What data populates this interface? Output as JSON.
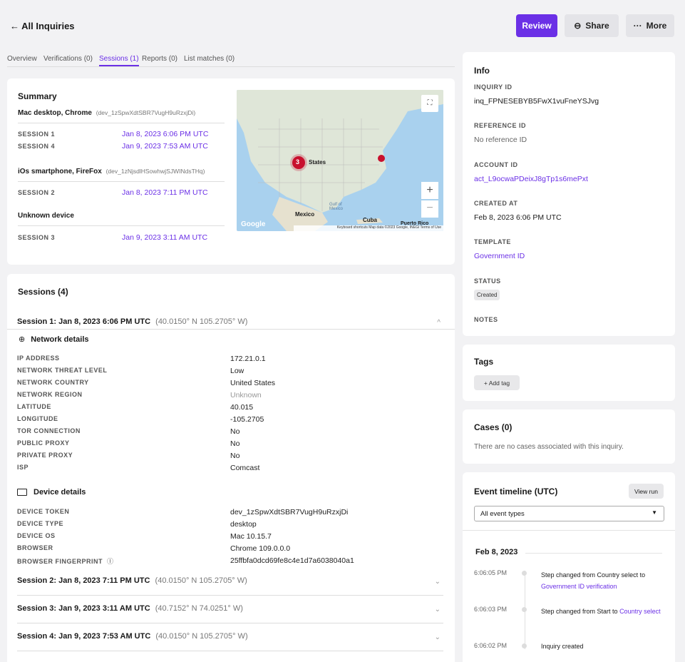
{
  "header": {
    "back_label": "← All Inquiries",
    "review": "Review",
    "share": "Share",
    "more": "More"
  },
  "tabs": [
    {
      "label": "Overview"
    },
    {
      "label": "Verifications (0)"
    },
    {
      "label": "Sessions (1)"
    },
    {
      "label": "Reports (0)"
    },
    {
      "label": "List matches (0)"
    }
  ],
  "summary": {
    "title": "Summary",
    "devices": [
      {
        "name": "Mac desktop, Chrome",
        "id": "(dev_1zSpwXdtSBR7VugH9uRzxjDi)",
        "sessions": [
          {
            "label": "SESSION 1",
            "time": "Jan 8, 2023 6:06 PM UTC"
          },
          {
            "label": "SESSION 4",
            "time": "Jan 9, 2023 7:53 AM UTC"
          }
        ]
      },
      {
        "name": "iOs smartphone, FireFox",
        "id": "(dev_1zNjsdlHSowhwjSJWINdsTHq)",
        "sessions": [
          {
            "label": "SESSION 2",
            "time": "Jan 8, 2023 7:11 PM UTC"
          }
        ]
      },
      {
        "name": "Unknown device",
        "id": "",
        "sessions": [
          {
            "label": "SESSION 3",
            "time": "Jan 9, 2023 3:11 AM UTC"
          }
        ]
      }
    ],
    "map": {
      "cluster_count": "3",
      "states_label": "States",
      "mexico": "Mexico",
      "cuba": "Cuba",
      "gulf": "Gulf of Mexico",
      "puerto_rico": "Puerto Rico",
      "google": "Google",
      "footer": "Keyboard shortcuts   Map data ©2023 Google, INEGI   Terms of Use",
      "zoom_in": "+",
      "zoom_out": "−"
    }
  },
  "sessions": {
    "title": "Sessions (4)",
    "s1": {
      "title": "Session 1: Jan 8, 2023 6:06 PM UTC",
      "coord": "(40.0150° N 105.2705° W)"
    },
    "network_title": "Network details",
    "network": [
      {
        "k": "IP ADDRESS",
        "v": "172.21.0.1"
      },
      {
        "k": "NETWORK THREAT LEVEL",
        "v": "Low"
      },
      {
        "k": "NETWORK COUNTRY",
        "v": "United States"
      },
      {
        "k": "NETWORK REGION",
        "v": "Unknown"
      },
      {
        "k": "LATITUDE",
        "v": "40.015"
      },
      {
        "k": "LONGITUDE",
        "v": "-105.2705"
      },
      {
        "k": "TOR CONNECTION",
        "v": "No"
      },
      {
        "k": "PUBLIC PROXY",
        "v": "No"
      },
      {
        "k": "PRIVATE PROXY",
        "v": "No"
      },
      {
        "k": "ISP",
        "v": "Comcast"
      }
    ],
    "device_title": "Device details",
    "device": [
      {
        "k": "DEVICE TOKEN",
        "v": "dev_1zSpwXdtSBR7VugH9uRzxjDi"
      },
      {
        "k": "DEVICE TYPE",
        "v": "desktop"
      },
      {
        "k": "DEVICE OS",
        "v": "Mac 10.15.7"
      },
      {
        "k": "BROWSER",
        "v": "Chrome 109.0.0.0"
      },
      {
        "k": "BROWSER FINGERPRINT",
        "v": "25ffbfa0dcd69fe8c4e1d7a6038040a1"
      }
    ],
    "s2": {
      "title": "Session 2: Jan 8, 2023 7:11 PM UTC",
      "coord": "(40.0150° N 105.2705° W)"
    },
    "s3": {
      "title": "Session 3: Jan 9, 2023 3:11 AM UTC",
      "coord": "(40.7152° N 74.0251° W)"
    },
    "s4": {
      "title": "Session 4: Jan 9, 2023 7:53 AM UTC",
      "coord": "(40.0150° N 105.2705° W)"
    }
  },
  "info": {
    "title": "Info",
    "inquiry_id_label": "INQUIRY ID",
    "inquiry_id": "inq_FPNESEBYB5FwX1vuFneYSJvg",
    "reference_id_label": "REFERENCE ID",
    "reference_id": "No reference ID",
    "account_id_label": "ACCOUNT ID",
    "account_id": "act_L9ocwaPDeixJ8gTp1s6mePxt",
    "created_at_label": "CREATED AT",
    "created_at": "Feb 8, 2023 6:06 PM UTC",
    "template_label": "TEMPLATE",
    "template": "Government ID",
    "status_label": "STATUS",
    "status": "Created",
    "notes_label": "NOTES"
  },
  "tags": {
    "title": "Tags",
    "add": "+ Add tag"
  },
  "cases": {
    "title": "Cases (0)",
    "empty": "There are no cases associated with this inquiry."
  },
  "timeline": {
    "title": "Event timeline (UTC)",
    "view_run": "View run",
    "filter": "All event types",
    "date": "Feb 8, 2023",
    "events": [
      {
        "time": "6:06:05 PM",
        "text": "Step changed from Country select to ",
        "link": "Government ID verification"
      },
      {
        "time": "6:06:03 PM",
        "text": "Step changed from Start to ",
        "link": "Country select"
      },
      {
        "time": "6:06:02 PM",
        "text": "Inquiry created",
        "link": ""
      }
    ]
  },
  "colors": {
    "accent": "#6b30e6",
    "marker": "#c8102e",
    "water": "#a9d1ee",
    "land": "#dfe6d8"
  }
}
